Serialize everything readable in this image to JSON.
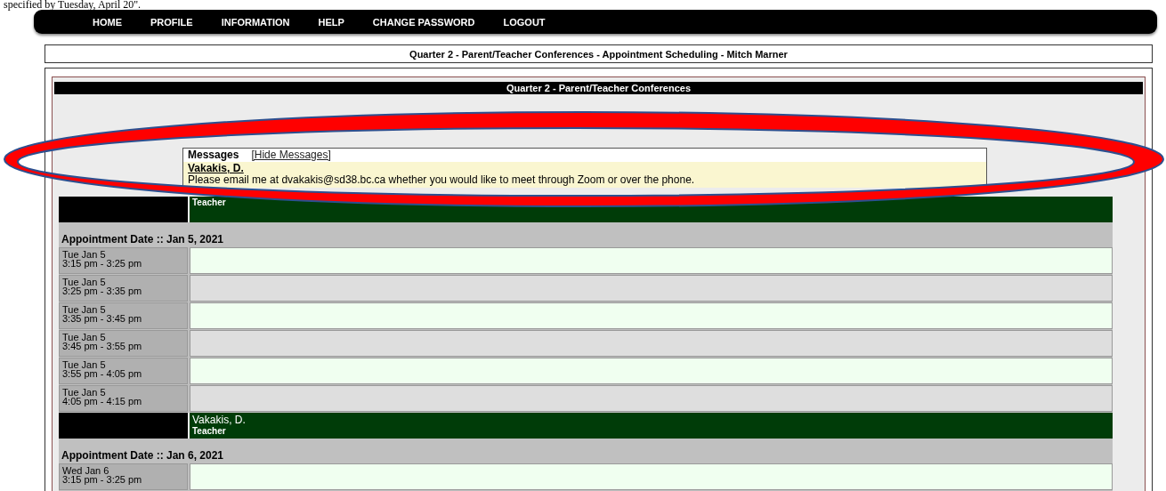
{
  "intro_text": "specified by Tuesday, April 20\".",
  "nav": [
    {
      "label": "HOME"
    },
    {
      "label": "PROFILE"
    },
    {
      "label": "INFORMATION"
    },
    {
      "label": "HELP"
    },
    {
      "label": "CHANGE PASSWORD"
    },
    {
      "label": "LOGOUT"
    }
  ],
  "page_title": "Quarter 2 - Parent/Teacher Conferences - Appointment Scheduling - Mitch Marner",
  "panel": {
    "header": "Quarter 2 - Parent/Teacher Conferences",
    "messages": {
      "title": "Messages",
      "toggle": "[Hide Messages]",
      "entries": [
        {
          "author": "Vakakis, D.",
          "text": "Please email me at dvakakis@sd38.bc.ca whether you would like to meet through Zoom or over the phone."
        }
      ]
    },
    "schedule": [
      {
        "role": "Teacher",
        "date_heading": "Appointment Date :: Jan 5, 2021",
        "slots": [
          {
            "day": "Tue Jan 5",
            "time": "3:15 pm - 3:25 pm"
          },
          {
            "day": "Tue Jan 5",
            "time": "3:25 pm - 3:35 pm"
          },
          {
            "day": "Tue Jan 5",
            "time": "3:35 pm - 3:45 pm"
          },
          {
            "day": "Tue Jan 5",
            "time": "3:45 pm - 3:55 pm"
          },
          {
            "day": "Tue Jan 5",
            "time": "3:55 pm - 4:05 pm"
          },
          {
            "day": "Tue Jan 5",
            "time": "4:05 pm - 4:15 pm"
          }
        ]
      },
      {
        "name": "Vakakis, D.",
        "role": "Teacher",
        "date_heading": "Appointment Date :: Jan 6, 2021",
        "slots": [
          {
            "day": "Wed Jan 6",
            "time": "3:15 pm - 3:25 pm"
          }
        ]
      }
    ]
  },
  "annotation": {
    "kind": "ellipse"
  }
}
